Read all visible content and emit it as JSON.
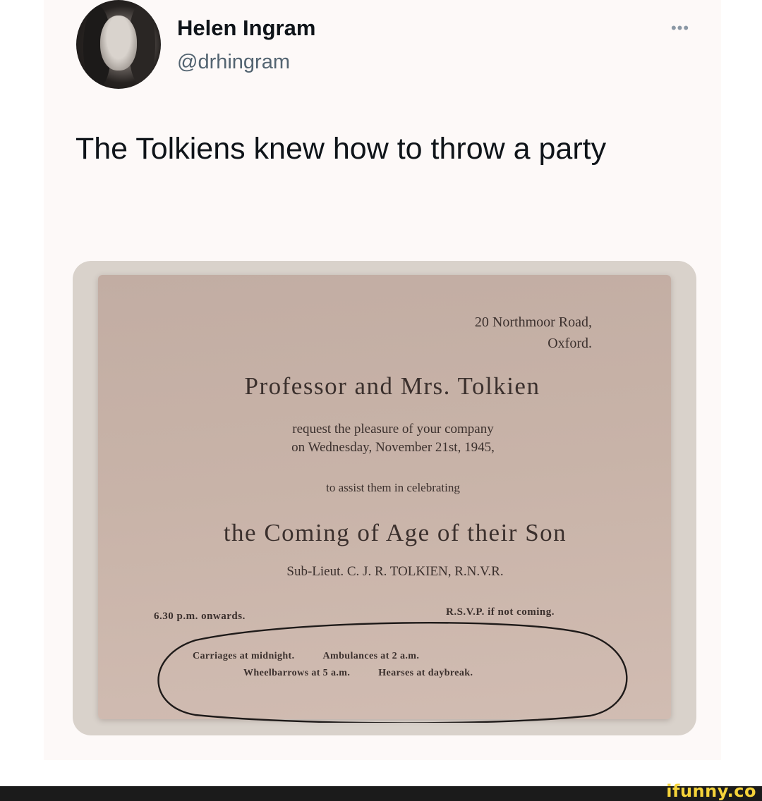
{
  "tweet": {
    "author_name": "Helen Ingram",
    "author_handle": "@drhingram",
    "more_icon": "more-icon",
    "text": "The Tolkiens knew how to throw a party"
  },
  "invitation": {
    "address_line1": "20 Northmoor Road,",
    "address_line2": "Oxford.",
    "hosts": "Professor and Mrs. Tolkien",
    "request_line1": "request the pleasure of your company",
    "request_line2": "on Wednesday, November 21st, 1945,",
    "assist_line": "to assist them in celebrating",
    "occasion": "the Coming of Age of their Son",
    "honoree": "Sub-Lieut. C. J. R. TOLKIEN, R.N.V.R.",
    "time": "6.30 p.m. onwards.",
    "rsvp": "R.S.V.P. if not coming.",
    "fine_print": {
      "carriages": "Carriages at midnight.",
      "ambulances": "Ambulances at 2 a.m.",
      "wheelbarrows": "Wheelbarrows at 5 a.m.",
      "hearses": "Hearses at daybreak."
    }
  },
  "footer": {
    "brand": "ifunny.co",
    "brand_color": "#f5d33a"
  }
}
